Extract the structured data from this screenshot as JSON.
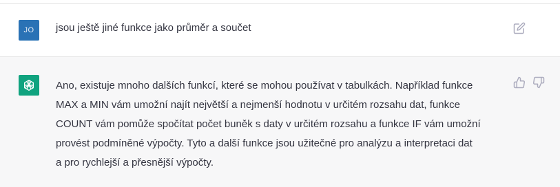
{
  "user_message": {
    "avatar_initials": "JO",
    "avatar_color": "#2a72b5",
    "text": "jsou ještě jiné funkce jako průměr a součet",
    "action_icon": "edit-icon"
  },
  "assistant_message": {
    "avatar_icon": "openai-logo-icon",
    "avatar_color": "#10a37f",
    "lines": [
      "Ano, existuje mnoho dalších funkcí, které se mohou používat v tabulkách. Například funkce",
      "MAX a MIN vám umožní najít největší a nejmenší hodnotu v určitém rozsahu dat, funkce",
      "COUNT vám pomůže spočítat počet buněk s daty v určitém rozsahu a funkce IF vám umožní",
      "provést podmíněné výpočty. Tyto a další funkce jsou užitečné pro analýzu a interpretaci dat",
      "a pro rychlejší a přesnější výpočty."
    ],
    "actions": [
      "thumbs-up-icon",
      "thumbs-down-icon"
    ],
    "row_background": "#f7f7f8"
  }
}
